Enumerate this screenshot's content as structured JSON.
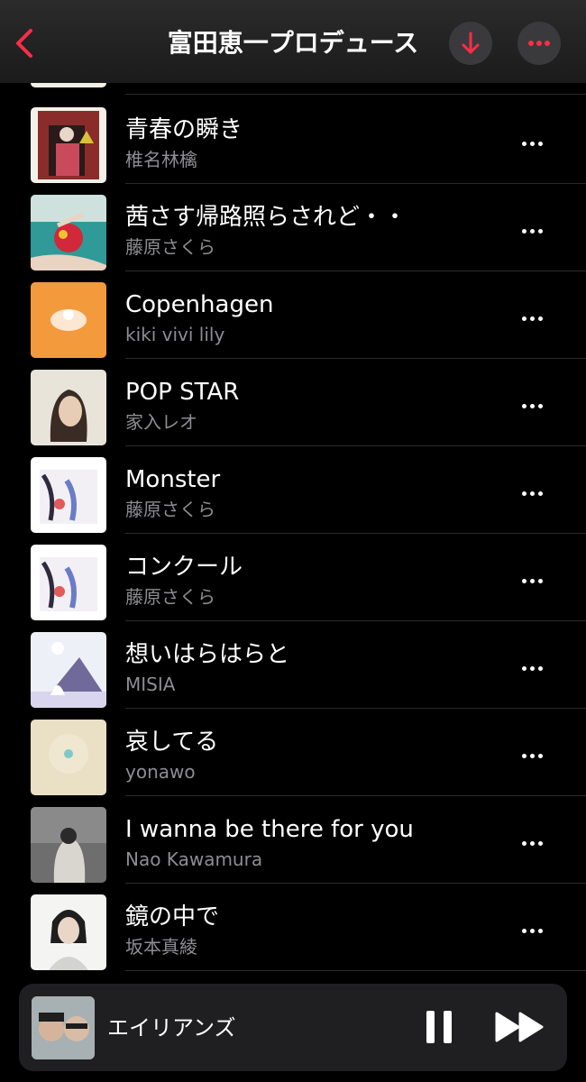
{
  "header": {
    "title": "富田恵一プロデュース",
    "back_icon": "chevron-left-icon",
    "download_icon": "download-arrow-icon",
    "more_icon": "ellipsis-icon",
    "accent": "#fa2d48"
  },
  "tracks": [
    {
      "title": "青春の瞬き",
      "artist": "椎名林檎"
    },
    {
      "title": "茜さす帰路照らされど・・",
      "artist": "藤原さくら"
    },
    {
      "title": "Copenhagen",
      "artist": "kiki vivi lily"
    },
    {
      "title": "POP STAR",
      "artist": "家入レオ"
    },
    {
      "title": "Monster",
      "artist": "藤原さくら"
    },
    {
      "title": "コンクール",
      "artist": "藤原さくら"
    },
    {
      "title": "想いはらはらと",
      "artist": "MISIA"
    },
    {
      "title": "哀してる",
      "artist": "yonawo"
    },
    {
      "title": "I wanna be there for you",
      "artist": "Nao Kawamura"
    },
    {
      "title": "鏡の中で",
      "artist": "坂本真綾"
    }
  ],
  "now_playing": {
    "title": "エイリアンズ",
    "pause_icon": "pause-icon",
    "next_icon": "fast-forward-icon"
  }
}
